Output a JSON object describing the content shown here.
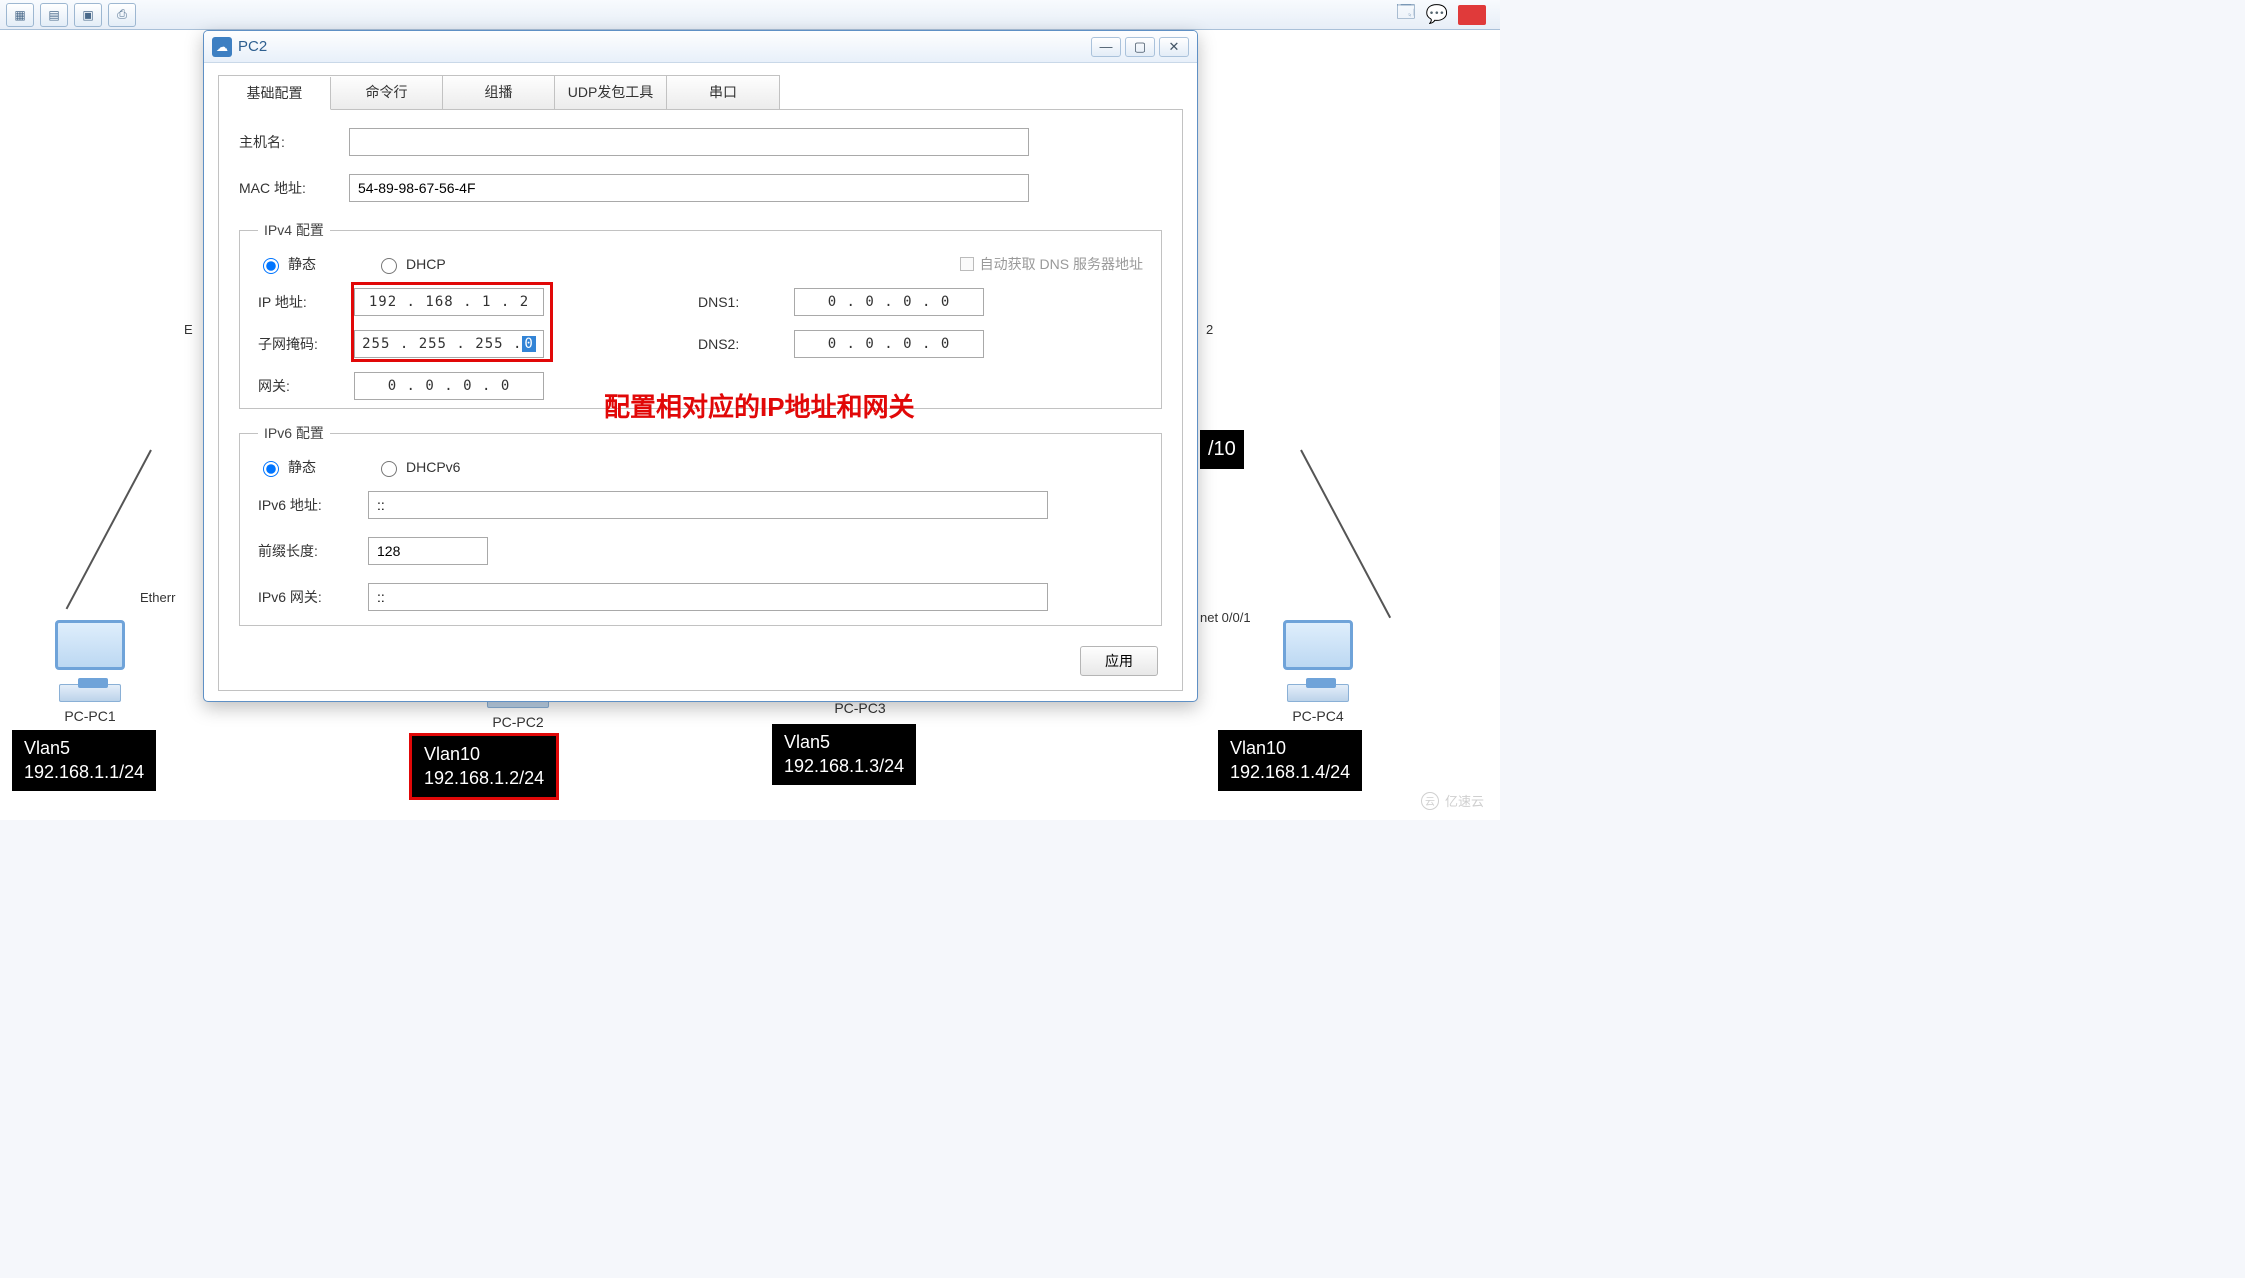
{
  "dialog": {
    "title": "PC2",
    "tabs": [
      "基础配置",
      "命令行",
      "组播",
      "UDP发包工具",
      "串口"
    ],
    "hostname_label": "主机名:",
    "hostname_value": "",
    "mac_label": "MAC 地址:",
    "mac_value": "54-89-98-67-56-4F",
    "ipv4_legend": "IPv4 配置",
    "ipv6_legend": "IPv6 配置",
    "static_label": "静态",
    "dhcp_label": "DHCP",
    "dhcpv6_label": "DHCPv6",
    "auto_dns_label": "自动获取 DNS 服务器地址",
    "ip_label": "IP 地址:",
    "ip_value": "192 . 168  .   1   .   2",
    "mask_label": "子网掩码:",
    "mask_value_prefix": "255  . 255  . 255  .  ",
    "mask_value_last": "0",
    "gw_label": "网关:",
    "gw_value": "0   .  0   .  0   .  0",
    "dns1_label": "DNS1:",
    "dns1_value": "0   .  0   .  0   .  0",
    "dns2_label": "DNS2:",
    "dns2_value": "0   .  0   .  0   .  0",
    "ipv6_addr_label": "IPv6 地址:",
    "ipv6_addr_value": "::",
    "prefix_label": "前缀长度:",
    "prefix_value": "128",
    "ipv6_gw_label": "IPv6 网关:",
    "ipv6_gw_value": "::",
    "apply_label": "应用",
    "annotation": "配置相对应的IP地址和网关"
  },
  "topology": {
    "port_left": "Etherr",
    "port_right": "net 0/0/1",
    "side_left": "E",
    "side_right": "2",
    "side_right_badge": "/10",
    "pcs": [
      {
        "name": "PC-PC1",
        "vlan": "Vlan5\n192.168.1.1/24"
      },
      {
        "name": "PC-PC2",
        "vlan": "Vlan10\n192.168.1.2/24"
      },
      {
        "name": "PC-PC3",
        "vlan": "Vlan5\n192.168.1.3/24"
      },
      {
        "name": "PC-PC4",
        "vlan": "Vlan10\n192.168.1.4/24"
      }
    ]
  },
  "watermark": "亿速云"
}
